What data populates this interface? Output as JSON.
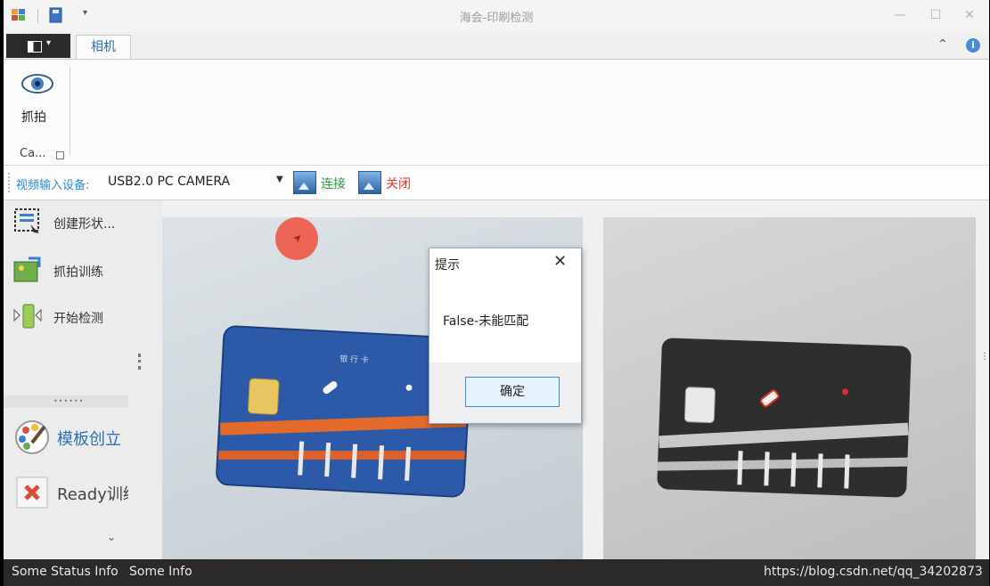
{
  "window": {
    "title": "海会-印刷检测",
    "minimize_glyph": "—",
    "maximize_glyph": "☐",
    "close_glyph": "✕"
  },
  "ribbon": {
    "tabs": [
      {
        "label": "相机",
        "selected": true
      }
    ],
    "collapse_glyph": "⌃",
    "help_glyph": "i",
    "capture_button_label": "抓拍",
    "group_label": "Ca..."
  },
  "toolbar": {
    "device_label": "视频输入设备:",
    "device_value": "USB2.0 PC CAMERA",
    "dropdown_glyph": "▼",
    "connect_label": "连接",
    "close_label": "关闭"
  },
  "left_panel": {
    "items": [
      {
        "label": "创建形状..."
      },
      {
        "label": "抓拍训练"
      },
      {
        "label": "开始检测"
      }
    ],
    "splitter_dots": "••••••",
    "big_items": [
      {
        "label": "模板创立"
      },
      {
        "label": "Ready训练"
      }
    ],
    "scroll_glyph": "⌄"
  },
  "card_text": "银 行 卡",
  "dialog": {
    "title": "提示",
    "close_glyph": "✕",
    "message": "False-未能匹配",
    "ok_label": "确定"
  },
  "statusbar": {
    "status1": "Some Status Info",
    "status2": "Some Info",
    "watermark": "https://blog.csdn.net/qq_34202873"
  },
  "colors": {
    "accent": "#2b6fb5",
    "connect": "#2a9b3e",
    "close": "#e0322b",
    "statusbar": "#2a2a2a"
  },
  "icons": [
    "app-icon",
    "save-icon",
    "eye-icon",
    "picture-icon",
    "shape-icon",
    "train-icon",
    "detect-icon",
    "palette-icon",
    "ready-icon"
  ]
}
